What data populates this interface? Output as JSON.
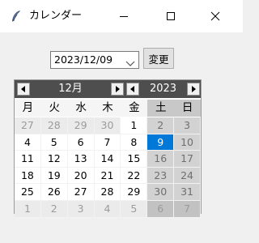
{
  "window": {
    "title": "カレンダー",
    "icon": "feather-icon"
  },
  "date_combo": {
    "value": "2023/12/09"
  },
  "change_button": {
    "label": "変更"
  },
  "calendar": {
    "month_label": "12月",
    "year_label": "2023",
    "weekdays": [
      "月",
      "火",
      "水",
      "木",
      "金",
      "土",
      "日"
    ],
    "weeks": [
      [
        "27",
        "28",
        "29",
        "30",
        "1",
        "2",
        "3"
      ],
      [
        "4",
        "5",
        "6",
        "7",
        "8",
        "9",
        "10"
      ],
      [
        "11",
        "12",
        "13",
        "14",
        "15",
        "16",
        "17"
      ],
      [
        "18",
        "19",
        "20",
        "21",
        "22",
        "23",
        "24"
      ],
      [
        "25",
        "26",
        "27",
        "28",
        "29",
        "30",
        "31"
      ],
      [
        "1",
        "2",
        "3",
        "4",
        "5",
        "6",
        "7"
      ]
    ],
    "selected_day": "9",
    "colors": {
      "header_bg": "#4e4e4e",
      "selected_bg": "#0078d7"
    }
  }
}
